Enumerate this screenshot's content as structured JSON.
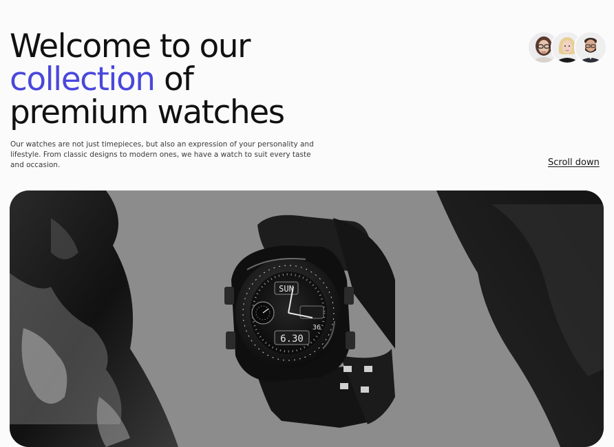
{
  "hero": {
    "title_line1": "Welcome to our",
    "title_accent": "collection",
    "title_line2_rest": " of",
    "title_line3": "premium watches",
    "description": "Our watches are not just timepieces, but also an expression of your personality and lifestyle. From classic designs to modern ones, we have a watch to suit every taste and occasion.",
    "scroll_label": "Scroll down"
  },
  "watch_display": {
    "day": "SUN",
    "time": "6.30",
    "small_digits": "36"
  },
  "avatars": [
    {
      "name": "avatar-woman-glasses"
    },
    {
      "name": "avatar-woman-blonde"
    },
    {
      "name": "avatar-man-beard"
    }
  ],
  "colors": {
    "accent": "#4a47dc",
    "text": "#111111",
    "background": "#fbfbfc",
    "image_background": "#8b8b8b"
  },
  "icons": [
    "watch-image",
    "rock-image"
  ]
}
